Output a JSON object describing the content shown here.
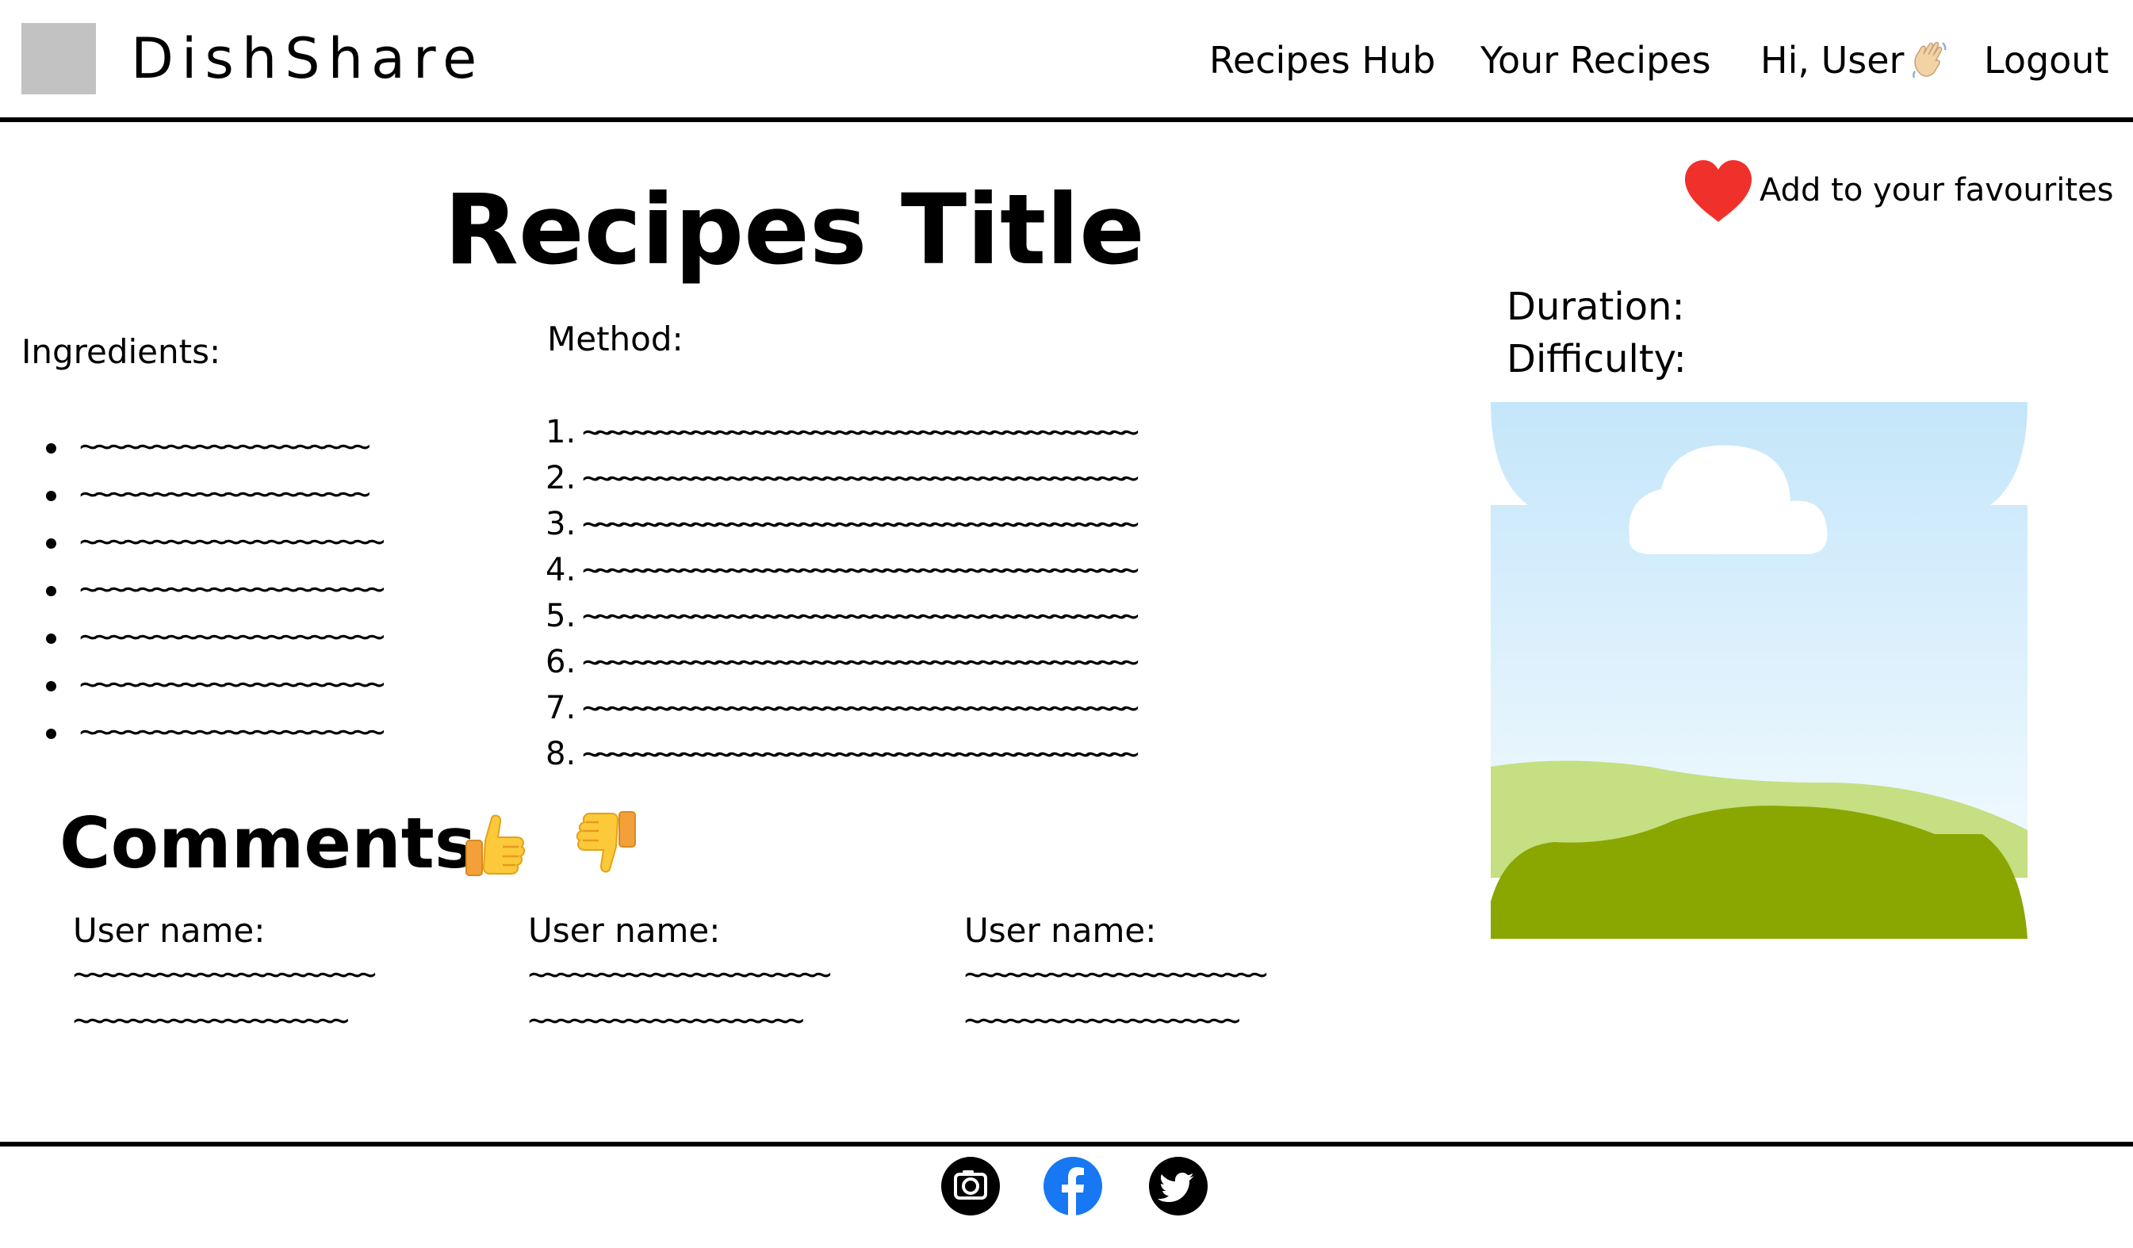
{
  "header": {
    "brand": "DishShare",
    "nav": {
      "recipes_hub": "Recipes Hub",
      "your_recipes": "Your Recipes",
      "greeting": "Hi, User",
      "logout": "Logout"
    }
  },
  "recipe": {
    "title": "Recipes Title",
    "favourite_label": "Add to your favourites",
    "duration_label": "Duration:",
    "difficulty_label": "Difficulty:",
    "ingredients_heading": "Ingredients:",
    "ingredients": [
      "~~~~~~~~~~~~~~~~~~~~",
      "~~~~~~~~~~~~~~~~~~~~",
      "~~~~~~~~~~~~~~~~~~~~~",
      "~~~~~~~~~~~~~~~~~~~~~",
      "~~~~~~~~~~~~~~~~~~~~~",
      "~~~~~~~~~~~~~~~~~~~~~",
      "~~~~~~~~~~~~~~~~~~~~~"
    ],
    "method_heading": "Method:",
    "method": [
      {
        "num": "1.",
        "text": "~~~~~~~~~~~~~~~~~~~~~~~~~~~~~~~~~~~~~~~~~~~~~~"
      },
      {
        "num": "2.",
        "text": "~~~~~~~~~~~~~~~~~~~~~~~~~~~~~~~~~~~~~~~~~~~~~~"
      },
      {
        "num": "3.",
        "text": "~~~~~~~~~~~~~~~~~~~~~~~~~~~~~~~~~~~~~~~~~~~~~~"
      },
      {
        "num": "4.",
        "text": "~~~~~~~~~~~~~~~~~~~~~~~~~~~~~~~~~~~~~~~~~~~~~~"
      },
      {
        "num": "5.",
        "text": "~~~~~~~~~~~~~~~~~~~~~~~~~~~~~~~~~~~~~~~~~~~~~~"
      },
      {
        "num": "6.",
        "text": "~~~~~~~~~~~~~~~~~~~~~~~~~~~~~~~~~~~~~~~~~~~~~~"
      },
      {
        "num": "7.",
        "text": "~~~~~~~~~~~~~~~~~~~~~~~~~~~~~~~~~~~~~~~~~~~~~~"
      },
      {
        "num": "8.",
        "text": "~~~~~~~~~~~~~~~~~~~~~~~~~~~~~~~~~~~~~~~~~~~~~~"
      }
    ]
  },
  "comments": {
    "heading": "Comments",
    "items": [
      {
        "user_label": "User name:",
        "line1": "~~~~~~~~~~~~~~~~~~~~~~",
        "line2": "~~~~~~~~~~~~~~~~~~~~"
      },
      {
        "user_label": "User name:",
        "line1": "~~~~~~~~~~~~~~~~~~~~~~",
        "line2": "~~~~~~~~~~~~~~~~~~~~"
      },
      {
        "user_label": "User name:",
        "line1": "~~~~~~~~~~~~~~~~~~~~~~",
        "line2": "~~~~~~~~~~~~~~~~~~~~"
      }
    ]
  },
  "icons": {
    "logo": "logo-placeholder",
    "wave": "waving-hand-icon",
    "favourite": "heart-icon",
    "thumbs_up": "thumbs-up-icon",
    "thumbs_down": "thumbs-down-icon",
    "recipe_image": "image-placeholder-icon",
    "social": [
      "instagram-icon",
      "facebook-icon",
      "twitter-icon"
    ]
  },
  "colors": {
    "heart": "#f0302a",
    "facebook": "#1877f2",
    "sky": "#c9e9fb",
    "grass_light": "#c5df82",
    "grass_dark": "#8aa600",
    "emoji_yellow": "#fbc93a"
  }
}
